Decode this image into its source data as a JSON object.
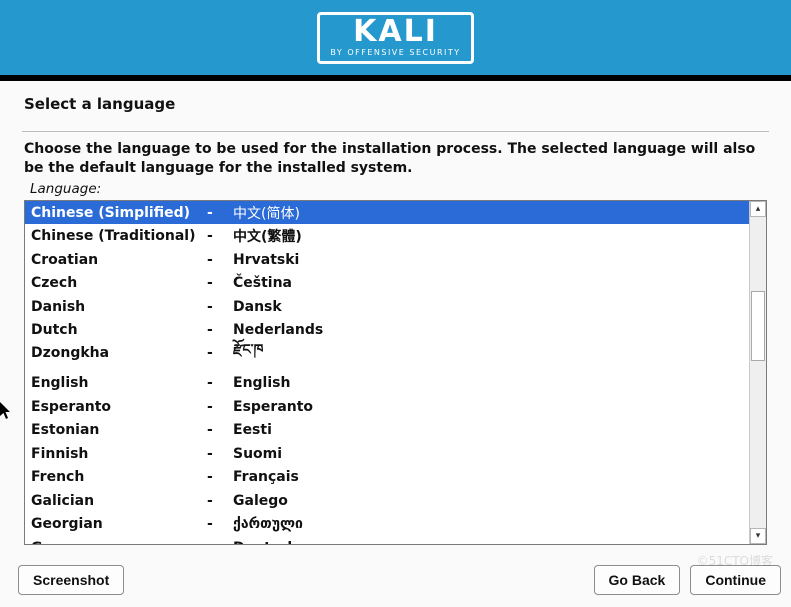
{
  "brand": {
    "name": "KALI",
    "tagline": "BY OFFENSIVE SECURITY"
  },
  "page": {
    "title": "Select a language",
    "instruction": "Choose the language to be used for the installation process. The selected language will also be the default language for the installed system.",
    "field_label": "Language:"
  },
  "selected_index": 0,
  "languages": [
    {
      "english": "Chinese (Simplified)",
      "native": "中文(简体)"
    },
    {
      "english": "Chinese (Traditional)",
      "native": "中文(繁體)"
    },
    {
      "english": "Croatian",
      "native": "Hrvatski"
    },
    {
      "english": "Czech",
      "native": "Čeština"
    },
    {
      "english": "Danish",
      "native": "Dansk"
    },
    {
      "english": "Dutch",
      "native": "Nederlands"
    },
    {
      "english": "Dzongkha",
      "native": "རྫོང་ཁ"
    },
    {
      "english": "English",
      "native": "English"
    },
    {
      "english": "Esperanto",
      "native": "Esperanto"
    },
    {
      "english": "Estonian",
      "native": "Eesti"
    },
    {
      "english": "Finnish",
      "native": "Suomi"
    },
    {
      "english": "French",
      "native": "Français"
    },
    {
      "english": "Galician",
      "native": "Galego"
    },
    {
      "english": "Georgian",
      "native": "ქართული"
    },
    {
      "english": "German",
      "native": "Deutsch"
    }
  ],
  "gap_after_index": 6,
  "buttons": {
    "screenshot": "Screenshot",
    "go_back": "Go Back",
    "continue": "Continue"
  },
  "watermark": "©51CTO博客"
}
